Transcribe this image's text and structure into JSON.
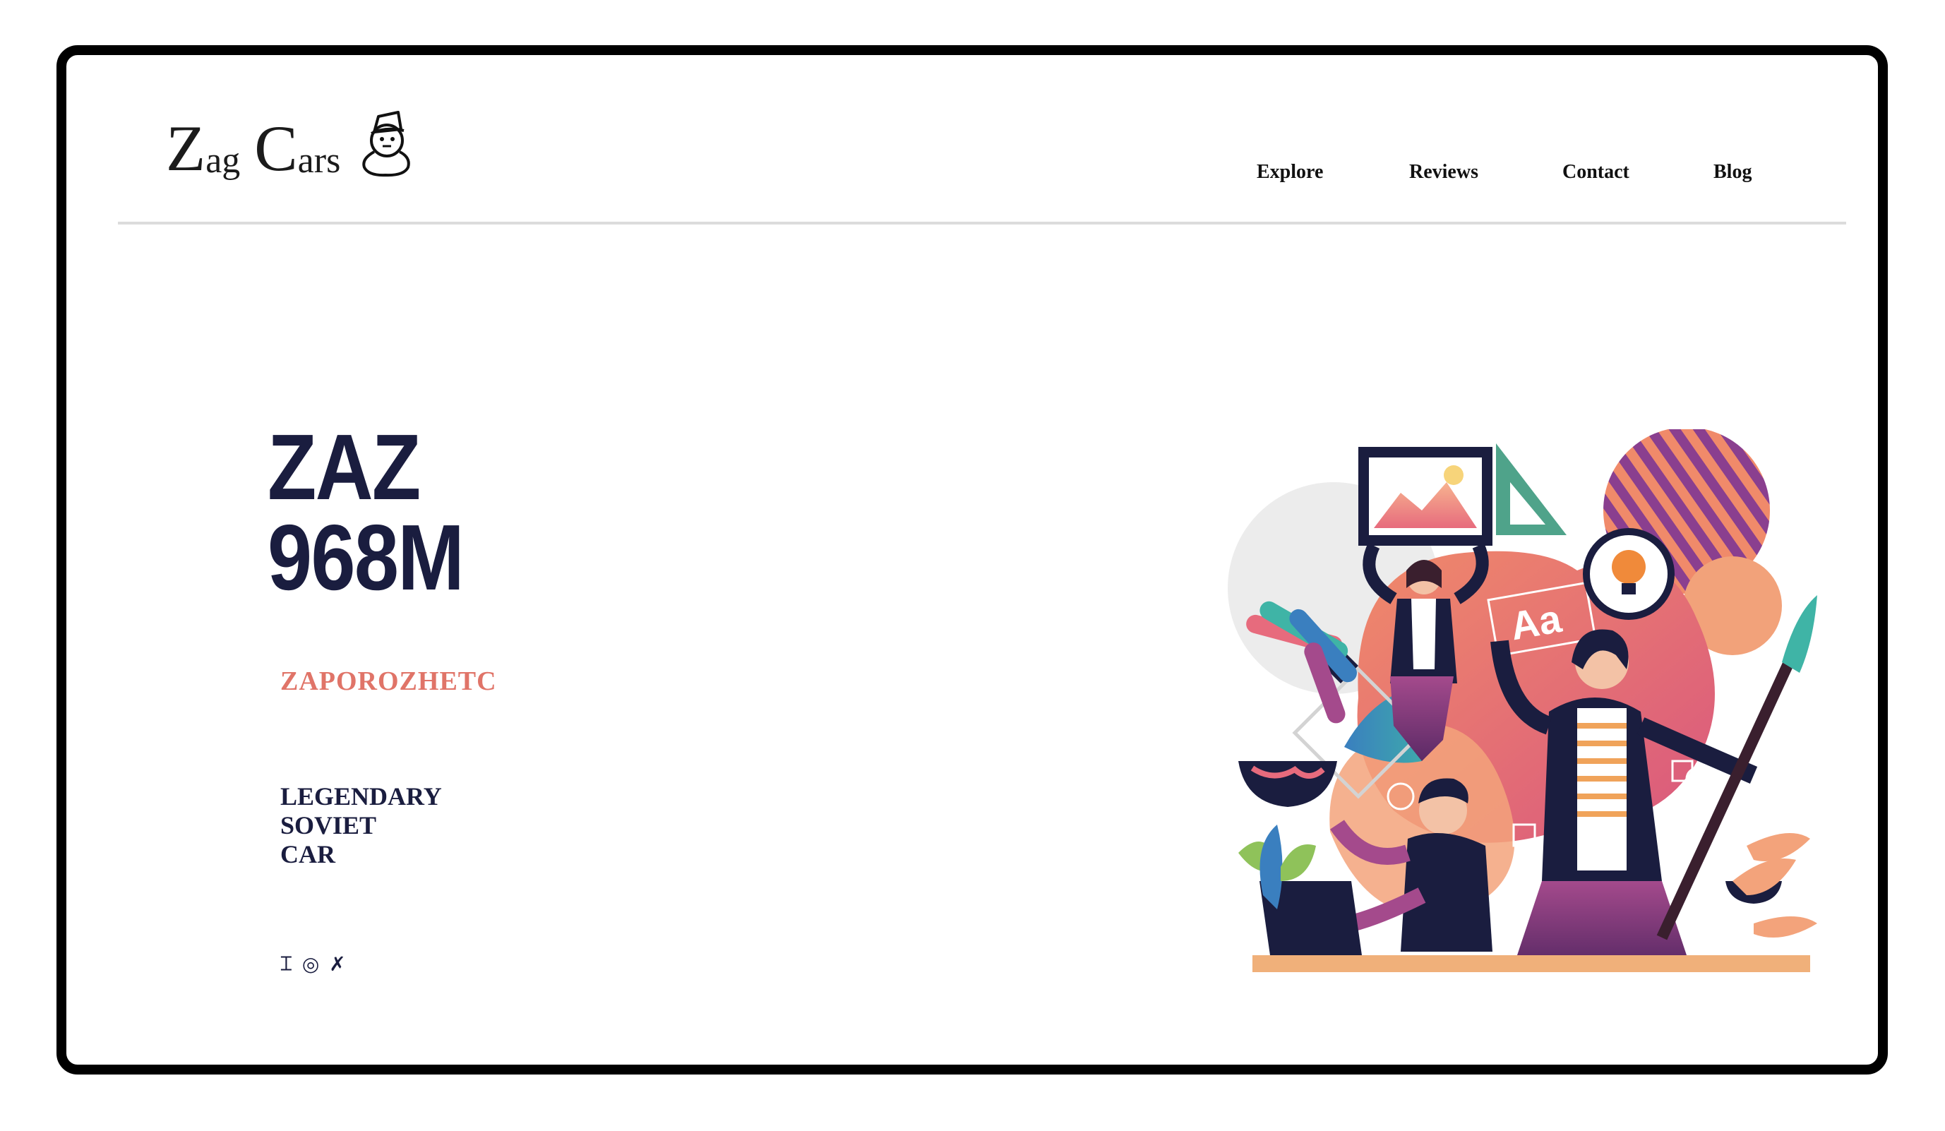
{
  "brand": {
    "logo_word1_initial": "Z",
    "logo_word1_rest": "ag",
    "logo_word2_initial": "C",
    "logo_word2_rest": "ars",
    "logo_icon": "snowman-hat-icon"
  },
  "nav": {
    "items": [
      {
        "label": "Explore"
      },
      {
        "label": "Reviews"
      },
      {
        "label": "Contact"
      },
      {
        "label": "Blog"
      }
    ]
  },
  "hero": {
    "title_line1": "ZAZ",
    "title_line2": "968M",
    "subtitle": "ZAPOROZHETC",
    "tagline": [
      "LEGENDARY",
      "SOVIET",
      "CAR"
    ]
  },
  "social": [
    {
      "glyph": "⌶",
      "icon": "instagram-icon"
    },
    {
      "glyph": "◎",
      "icon": "dribbble-icon"
    },
    {
      "glyph": "✗",
      "icon": "twitter-icon"
    }
  ],
  "colors": {
    "navy": "#1a1d3f",
    "coral": "#e07468",
    "divider": "#dcdcdc"
  },
  "illustration": {
    "icon": "creative-team-illustration"
  }
}
